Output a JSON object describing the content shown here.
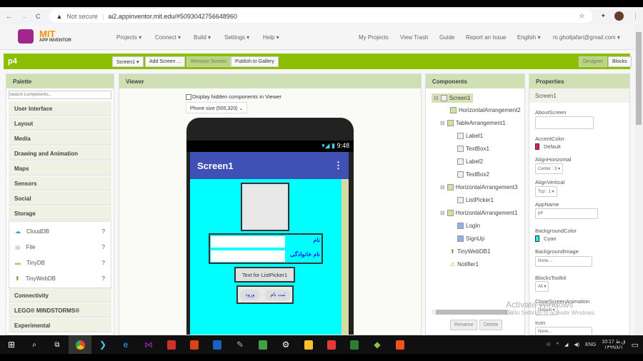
{
  "browser": {
    "url_warning": "Not secure",
    "url": "ai2.appinventor.mit.edu/#5093042756648960"
  },
  "header": {
    "logo_top": "MIT",
    "logo_bottom": "APP INVENTOR",
    "menus": [
      "Projects ▾",
      "Connect ▾",
      "Build ▾",
      "Settings ▾",
      "Help ▾"
    ],
    "right_links": [
      "My Projects",
      "View Trash",
      "Guide",
      "Report an Issue",
      "English ▾",
      "m.gholijafari@gmail.com ▾"
    ]
  },
  "toolbar": {
    "project": "p4",
    "screen_select": "Screen1 ▾",
    "add_screen": "Add Screen ...",
    "remove_screen": "Remove Screen",
    "publish": "Publish to Gallery",
    "designer": "Designer",
    "blocks": "Blocks"
  },
  "palette": {
    "title": "Palette",
    "search_placeholder": "Search Components...",
    "categories_before": [
      "User Interface",
      "Layout",
      "Media",
      "Drawing and Animation",
      "Maps",
      "Sensors",
      "Social",
      "Storage"
    ],
    "storage_items": [
      "CloudDB",
      "File",
      "TinyDB",
      "TinyWebDB"
    ],
    "categories_after": [
      "Connectivity",
      "LEGO® MINDSTORMS®",
      "Experimental"
    ],
    "help": "?"
  },
  "viewer": {
    "title": "Viewer",
    "hidden_checkbox": "Display hidden components in Viewer",
    "phone_size": "Phone size (505,320)",
    "time": "9:48",
    "screen_title": "Screen1",
    "label1": "نام",
    "label2": "نام خانوادگی",
    "listpicker": "Text for ListPicker1",
    "login": "ورود",
    "signup": "ثبت نام"
  },
  "components": {
    "title": "Components",
    "tree": [
      "Screen1",
      "HorizontalArrangement2",
      "TableArrangement1",
      "Label1",
      "TextBox1",
      "Label2",
      "TextBox2",
      "HorizontalArrangement3",
      "ListPicker1",
      "HorizontalArrangement1",
      "LogIn",
      "SignUp",
      "TinyWebDB1",
      "Notifier1"
    ],
    "rename": "Rename",
    "delete": "Delete"
  },
  "properties": {
    "title": "Properties",
    "component": "Screen1",
    "about_label": "AboutScreen",
    "accent_label": "AccentColor",
    "accent_value": "Default",
    "accent_color": "#e91e63",
    "alignh_label": "AlignHorizontal",
    "alignh_value": "Center : 3 ▾",
    "alignv_label": "AlignVertical",
    "alignv_value": "Top : 1 ▾",
    "appname_label": "AppName",
    "appname_value": "p4",
    "bg_label": "BackgroundColor",
    "bg_value": "Cyan",
    "bg_color": "#00ffff",
    "bgimg_label": "BackgroundImage",
    "bgimg_value": "None...",
    "blocks_label": "BlocksToolkit",
    "blocks_value": "All ▾",
    "close_label": "CloseScreenAnimation",
    "close_value": "Default ▾",
    "icon_label": "Icon",
    "icon_value": "None..."
  },
  "watermark": {
    "line1": "Activate Windows",
    "line2": "Go to Settings to activate Windows."
  },
  "taskbar": {
    "lang": "ENG",
    "time": "10:17 ق.ظ",
    "date": "۱۳۹۹/۸/۱"
  }
}
